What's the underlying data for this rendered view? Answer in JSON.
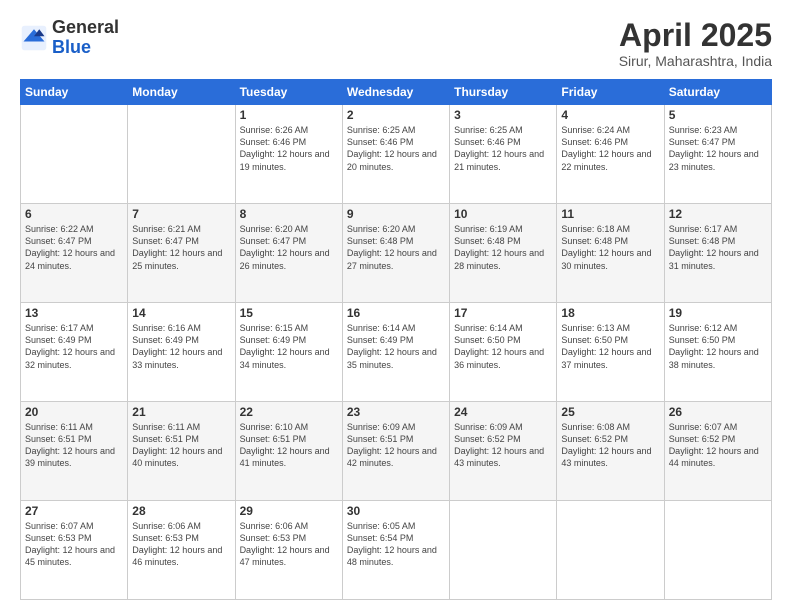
{
  "header": {
    "logo_general": "General",
    "logo_blue": "Blue",
    "month_title": "April 2025",
    "location": "Sirur, Maharashtra, India"
  },
  "days_of_week": [
    "Sunday",
    "Monday",
    "Tuesday",
    "Wednesday",
    "Thursday",
    "Friday",
    "Saturday"
  ],
  "weeks": [
    [
      {
        "day": "",
        "info": ""
      },
      {
        "day": "",
        "info": ""
      },
      {
        "day": "1",
        "info": "Sunrise: 6:26 AM\nSunset: 6:46 PM\nDaylight: 12 hours and 19 minutes."
      },
      {
        "day": "2",
        "info": "Sunrise: 6:25 AM\nSunset: 6:46 PM\nDaylight: 12 hours and 20 minutes."
      },
      {
        "day": "3",
        "info": "Sunrise: 6:25 AM\nSunset: 6:46 PM\nDaylight: 12 hours and 21 minutes."
      },
      {
        "day": "4",
        "info": "Sunrise: 6:24 AM\nSunset: 6:46 PM\nDaylight: 12 hours and 22 minutes."
      },
      {
        "day": "5",
        "info": "Sunrise: 6:23 AM\nSunset: 6:47 PM\nDaylight: 12 hours and 23 minutes."
      }
    ],
    [
      {
        "day": "6",
        "info": "Sunrise: 6:22 AM\nSunset: 6:47 PM\nDaylight: 12 hours and 24 minutes."
      },
      {
        "day": "7",
        "info": "Sunrise: 6:21 AM\nSunset: 6:47 PM\nDaylight: 12 hours and 25 minutes."
      },
      {
        "day": "8",
        "info": "Sunrise: 6:20 AM\nSunset: 6:47 PM\nDaylight: 12 hours and 26 minutes."
      },
      {
        "day": "9",
        "info": "Sunrise: 6:20 AM\nSunset: 6:48 PM\nDaylight: 12 hours and 27 minutes."
      },
      {
        "day": "10",
        "info": "Sunrise: 6:19 AM\nSunset: 6:48 PM\nDaylight: 12 hours and 28 minutes."
      },
      {
        "day": "11",
        "info": "Sunrise: 6:18 AM\nSunset: 6:48 PM\nDaylight: 12 hours and 30 minutes."
      },
      {
        "day": "12",
        "info": "Sunrise: 6:17 AM\nSunset: 6:48 PM\nDaylight: 12 hours and 31 minutes."
      }
    ],
    [
      {
        "day": "13",
        "info": "Sunrise: 6:17 AM\nSunset: 6:49 PM\nDaylight: 12 hours and 32 minutes."
      },
      {
        "day": "14",
        "info": "Sunrise: 6:16 AM\nSunset: 6:49 PM\nDaylight: 12 hours and 33 minutes."
      },
      {
        "day": "15",
        "info": "Sunrise: 6:15 AM\nSunset: 6:49 PM\nDaylight: 12 hours and 34 minutes."
      },
      {
        "day": "16",
        "info": "Sunrise: 6:14 AM\nSunset: 6:49 PM\nDaylight: 12 hours and 35 minutes."
      },
      {
        "day": "17",
        "info": "Sunrise: 6:14 AM\nSunset: 6:50 PM\nDaylight: 12 hours and 36 minutes."
      },
      {
        "day": "18",
        "info": "Sunrise: 6:13 AM\nSunset: 6:50 PM\nDaylight: 12 hours and 37 minutes."
      },
      {
        "day": "19",
        "info": "Sunrise: 6:12 AM\nSunset: 6:50 PM\nDaylight: 12 hours and 38 minutes."
      }
    ],
    [
      {
        "day": "20",
        "info": "Sunrise: 6:11 AM\nSunset: 6:51 PM\nDaylight: 12 hours and 39 minutes."
      },
      {
        "day": "21",
        "info": "Sunrise: 6:11 AM\nSunset: 6:51 PM\nDaylight: 12 hours and 40 minutes."
      },
      {
        "day": "22",
        "info": "Sunrise: 6:10 AM\nSunset: 6:51 PM\nDaylight: 12 hours and 41 minutes."
      },
      {
        "day": "23",
        "info": "Sunrise: 6:09 AM\nSunset: 6:51 PM\nDaylight: 12 hours and 42 minutes."
      },
      {
        "day": "24",
        "info": "Sunrise: 6:09 AM\nSunset: 6:52 PM\nDaylight: 12 hours and 43 minutes."
      },
      {
        "day": "25",
        "info": "Sunrise: 6:08 AM\nSunset: 6:52 PM\nDaylight: 12 hours and 43 minutes."
      },
      {
        "day": "26",
        "info": "Sunrise: 6:07 AM\nSunset: 6:52 PM\nDaylight: 12 hours and 44 minutes."
      }
    ],
    [
      {
        "day": "27",
        "info": "Sunrise: 6:07 AM\nSunset: 6:53 PM\nDaylight: 12 hours and 45 minutes."
      },
      {
        "day": "28",
        "info": "Sunrise: 6:06 AM\nSunset: 6:53 PM\nDaylight: 12 hours and 46 minutes."
      },
      {
        "day": "29",
        "info": "Sunrise: 6:06 AM\nSunset: 6:53 PM\nDaylight: 12 hours and 47 minutes."
      },
      {
        "day": "30",
        "info": "Sunrise: 6:05 AM\nSunset: 6:54 PM\nDaylight: 12 hours and 48 minutes."
      },
      {
        "day": "",
        "info": ""
      },
      {
        "day": "",
        "info": ""
      },
      {
        "day": "",
        "info": ""
      }
    ]
  ]
}
